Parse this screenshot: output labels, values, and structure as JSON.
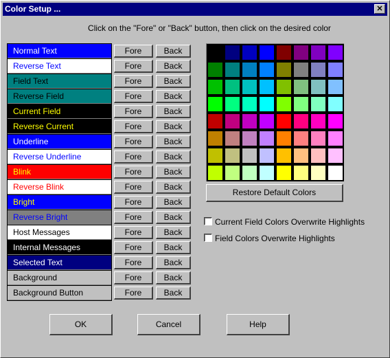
{
  "window": {
    "title": "Color Setup ...",
    "close_label": "✕"
  },
  "instruction": "Click on the \"Fore\" or \"Back\" button, then click on the desired color",
  "items": [
    {
      "label": "Normal Text",
      "fore": "#ffffff",
      "back": "#0000ff"
    },
    {
      "label": "Reverse Text",
      "fore": "#0000ff",
      "back": "#ffffff"
    },
    {
      "label": "Field Text",
      "fore": "#000000",
      "back": "#008080"
    },
    {
      "label": "Reverse Field",
      "fore": "#000000",
      "back": "#008080"
    },
    {
      "label": "Current Field",
      "fore": "#ffff00",
      "back": "#000000"
    },
    {
      "label": "Reverse Current",
      "fore": "#ffff00",
      "back": "#000000"
    },
    {
      "label": "Underline",
      "fore": "#ffffff",
      "back": "#0000ff"
    },
    {
      "label": "Reverse Underline",
      "fore": "#0000ff",
      "back": "#ffffff"
    },
    {
      "label": "Blink",
      "fore": "#ffff00",
      "back": "#ff0000"
    },
    {
      "label": "Reverse Blink",
      "fore": "#ff0000",
      "back": "#ffffff"
    },
    {
      "label": "Bright",
      "fore": "#ffff00",
      "back": "#0000ff"
    },
    {
      "label": "Reverse Bright",
      "fore": "#0000ff",
      "back": "#808080"
    },
    {
      "label": "Host Messages",
      "fore": "#000000",
      "back": "#ffffff"
    },
    {
      "label": "Internal Messages",
      "fore": "#ffffff",
      "back": "#000000"
    },
    {
      "label": "Selected Text",
      "fore": "#ffffff",
      "back": "#000080"
    },
    {
      "label": "Background",
      "fore": "#000000",
      "back": "#c0c0c0"
    },
    {
      "label": "Background Button",
      "fore": "#000000",
      "back": "#c0c0c0"
    }
  ],
  "fore_label": "Fore",
  "back_label": "Back",
  "palette": [
    "#000000",
    "#000080",
    "#0000c0",
    "#0000ff",
    "#800000",
    "#800080",
    "#8000c0",
    "#8000ff",
    "#008000",
    "#008080",
    "#0080c0",
    "#0080ff",
    "#808000",
    "#808080",
    "#8080c0",
    "#8080ff",
    "#00c000",
    "#00c080",
    "#00c0c0",
    "#00c0ff",
    "#80c000",
    "#80c080",
    "#80c0c0",
    "#80c0ff",
    "#00ff00",
    "#00ff80",
    "#00ffc0",
    "#00ffff",
    "#80ff00",
    "#80ff80",
    "#80ffc0",
    "#80ffff",
    "#c00000",
    "#c00080",
    "#c000c0",
    "#c000ff",
    "#ff0000",
    "#ff0080",
    "#ff00c0",
    "#ff00ff",
    "#c08000",
    "#c08080",
    "#c080c0",
    "#c080ff",
    "#ff8000",
    "#ff8080",
    "#ff80c0",
    "#ff80ff",
    "#c0c000",
    "#c0c080",
    "#c0c0c0",
    "#c0c0ff",
    "#ffc000",
    "#ffc080",
    "#ffc0c0",
    "#ffc0ff",
    "#c0ff00",
    "#c0ff80",
    "#c0ffc0",
    "#c0ffff",
    "#ffff00",
    "#ffff80",
    "#ffffc0",
    "#ffffff"
  ],
  "restore_label": "Restore Default Colors",
  "options": [
    {
      "label": "Current Field Colors Overwrite Highlights",
      "checked": false
    },
    {
      "label": "Field Colors Overwrite Highlights",
      "checked": false
    }
  ],
  "buttons": {
    "ok": "OK",
    "cancel": "Cancel",
    "help": "Help"
  }
}
